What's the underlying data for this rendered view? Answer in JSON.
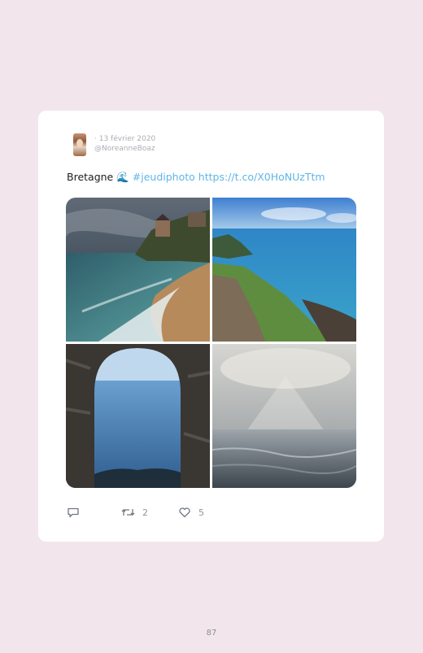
{
  "tweet": {
    "date": "· 13 février 2020",
    "handle": "@NoreanneBoaz",
    "text_plain": "Bretagne ",
    "emoji": "🌊",
    "hashtag": "#jeudiphoto",
    "url": "https://t.co/X0HoNUzTtm",
    "retweets": "2",
    "likes": "5"
  },
  "icons": {
    "reply": "reply-icon",
    "retweet": "retweet-icon",
    "like": "heart-icon"
  },
  "colors": {
    "background": "#f2e6ec",
    "card": "#ffffff",
    "link": "#5fb6e6",
    "meta": "#a9aeb5"
  },
  "page": {
    "number": "87"
  }
}
